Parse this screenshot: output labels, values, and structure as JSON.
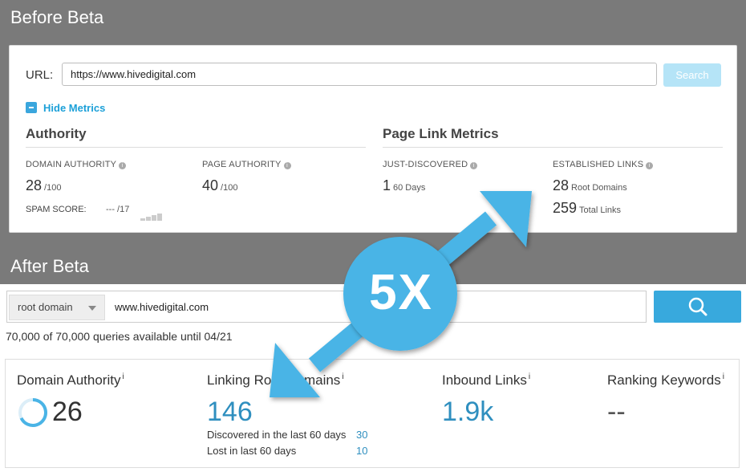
{
  "sections": {
    "before": "Before Beta",
    "after": "After Beta"
  },
  "old": {
    "url_label": "URL:",
    "url_value": "https://www.hivedigital.com",
    "search_label": "Search",
    "hide_metrics": "Hide Metrics",
    "authority_title": "Authority",
    "page_link_title": "Page Link Metrics",
    "domain_authority_label": "DOMAIN AUTHORITY",
    "domain_authority_value": "28",
    "domain_authority_suffix": "/100",
    "page_authority_label": "PAGE AUTHORITY",
    "page_authority_value": "40",
    "page_authority_suffix": "/100",
    "spam_label": "SPAM SCORE:",
    "spam_value": "--- /17",
    "just_discovered_label": "JUST-DISCOVERED",
    "just_discovered_value": "1",
    "just_discovered_suffix": "60 Days",
    "established_label": "ESTABLISHED LINKS",
    "root_domains_value": "28",
    "root_domains_suffix": "Root Domains",
    "total_links_value": "259",
    "total_links_suffix": "Total Links"
  },
  "new": {
    "dropdown_value": "root domain",
    "search_value": "www.hivedigital.com",
    "queries_text": "70,000 of 70,000 queries available until 04/21",
    "domain_authority_title": "Domain Authority",
    "domain_authority_value": "26",
    "linking_root_title": "Linking Root Domains",
    "linking_root_value": "146",
    "discovered_label": "Discovered in the last 60 days",
    "discovered_value": "30",
    "lost_label": "Lost in last 60 days",
    "lost_value": "10",
    "inbound_title": "Inbound Links",
    "inbound_value": "1.9k",
    "ranking_title": "Ranking Keywords",
    "ranking_value": "--",
    "info_mark": "i"
  },
  "callout": {
    "text": "5X",
    "color": "#4ab4e6"
  }
}
